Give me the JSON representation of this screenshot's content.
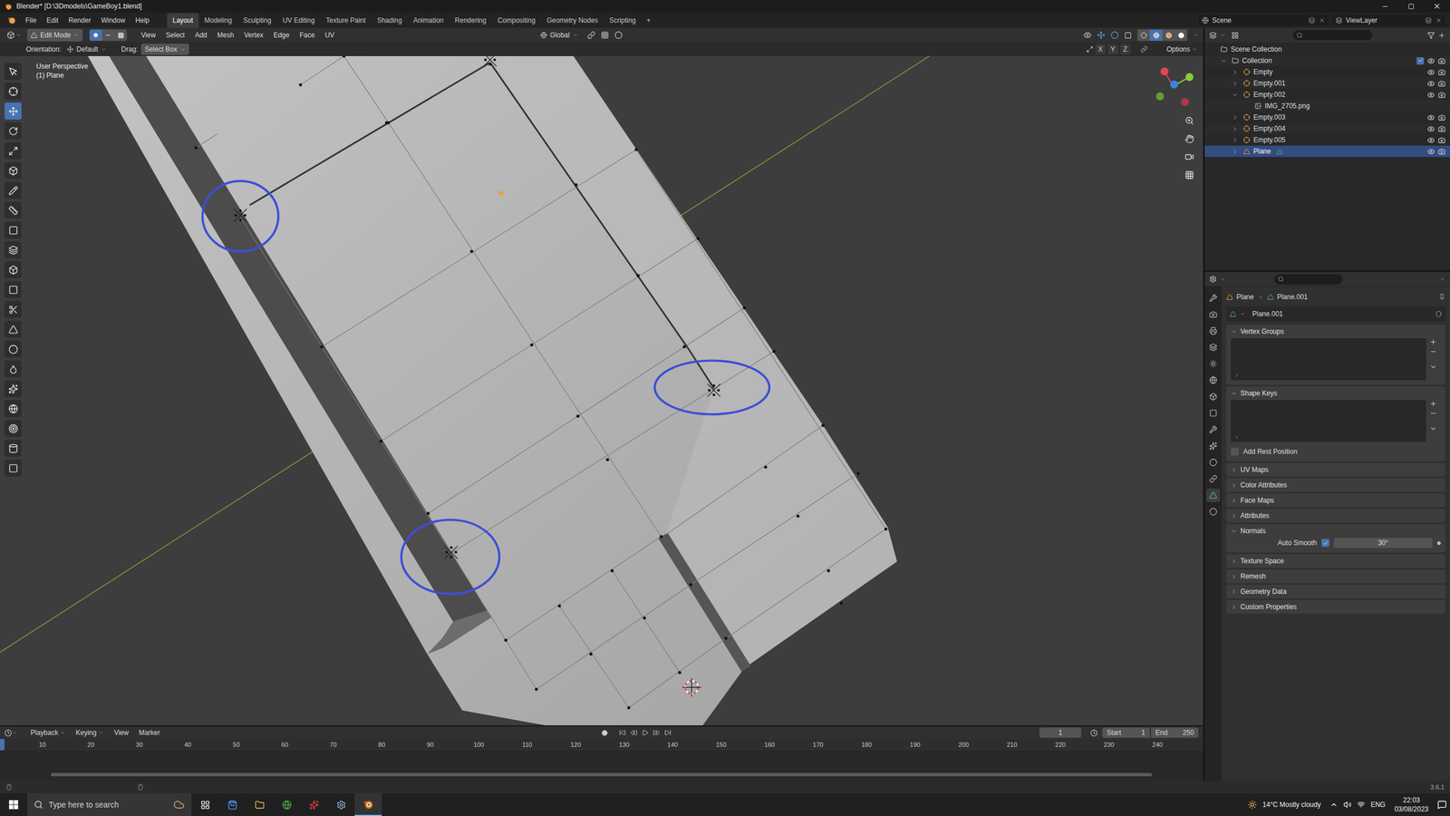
{
  "window": {
    "title": "Blender* [D:\\3Dmodels\\GameBoy1.blend]"
  },
  "menus": [
    "File",
    "Edit",
    "Render",
    "Window",
    "Help"
  ],
  "workspaces": [
    {
      "label": "Layout",
      "selected": true
    },
    {
      "label": "Modeling",
      "selected": false
    },
    {
      "label": "Sculpting",
      "selected": false
    },
    {
      "label": "UV Editing",
      "selected": false
    },
    {
      "label": "Texture Paint",
      "selected": false
    },
    {
      "label": "Shading",
      "selected": false
    },
    {
      "label": "Animation",
      "selected": false
    },
    {
      "label": "Rendering",
      "selected": false
    },
    {
      "label": "Compositing",
      "selected": false
    },
    {
      "label": "Geometry Nodes",
      "selected": false
    },
    {
      "label": "Scripting",
      "selected": false
    }
  ],
  "add_workspace": "+",
  "scene": "Scene",
  "view_layer": "ViewLayer",
  "viewport": {
    "mode": "Edit Mode",
    "select_modes": [
      {
        "selected": true
      },
      {
        "selected": false
      },
      {
        "selected": false
      }
    ],
    "menus": [
      "View",
      "Select",
      "Add",
      "Mesh",
      "Vertex",
      "Edge",
      "Face",
      "UV"
    ],
    "orientation": "Global",
    "shading": [
      {
        "selected": false
      },
      {
        "selected": true
      },
      {
        "selected": false
      },
      {
        "selected": false
      }
    ],
    "tool_settings": {
      "orientation_label": "Orientation:",
      "orientation": "Default",
      "drag_label": "Drag:",
      "drag": "Select Box",
      "mirror": [
        {
          "label": "X",
          "on": false
        },
        {
          "label": "Y",
          "on": false
        },
        {
          "label": "Z",
          "on": false
        }
      ],
      "options": "Options"
    },
    "overlay_text": [
      "User Perspective",
      "(1) Plane"
    ],
    "tools": [
      {
        "selected": false
      },
      {
        "selected": false
      },
      {
        "selected": true
      },
      {
        "selected": false
      },
      {
        "selected": false
      },
      {
        "selected": false
      },
      {
        "selected": false
      },
      {
        "selected": false
      },
      {
        "selected": false
      },
      {
        "selected": false
      },
      {
        "selected": false
      },
      {
        "selected": false
      },
      {
        "selected": false
      },
      {
        "selected": false
      },
      {
        "selected": false
      },
      {
        "selected": false
      },
      {
        "selected": false
      },
      {
        "selected": false
      },
      {
        "selected": false
      },
      {
        "selected": false
      },
      {
        "selected": false
      }
    ]
  },
  "outliner": {
    "rows": [
      {
        "name": "Scene Collection",
        "kind": "scene",
        "depth": 0,
        "selected": false
      },
      {
        "name": "Collection",
        "kind": "collection",
        "depth": 1,
        "expanded": true,
        "selected": false,
        "checked": true,
        "visible": true
      },
      {
        "name": "Empty",
        "kind": "empty",
        "depth": 2,
        "expanded": false,
        "selected": false,
        "visible": true
      },
      {
        "name": "Empty.001",
        "kind": "empty",
        "depth": 2,
        "expanded": false,
        "selected": false,
        "visible": true
      },
      {
        "name": "Empty.002",
        "kind": "empty",
        "depth": 2,
        "expanded": true,
        "selected": false,
        "visible": true
      },
      {
        "name": "IMG_2705.png",
        "kind": "image",
        "depth": 3,
        "selected": false
      },
      {
        "name": "Empty.003",
        "kind": "empty",
        "depth": 2,
        "expanded": false,
        "selected": false,
        "visible": true
      },
      {
        "name": "Empty.004",
        "kind": "empty",
        "depth": 2,
        "expanded": false,
        "selected": false,
        "visible": true
      },
      {
        "name": "Empty.005",
        "kind": "empty",
        "depth": 2,
        "expanded": false,
        "selected": false,
        "visible": true
      },
      {
        "name": "Plane",
        "kind": "mesh",
        "depth": 2,
        "expanded": false,
        "selected": true,
        "visible": true
      }
    ]
  },
  "properties": {
    "tabs": [
      {
        "selected": false
      },
      {
        "selected": false
      },
      {
        "selected": false
      },
      {
        "selected": false
      },
      {
        "selected": false
      },
      {
        "selected": false
      },
      {
        "selected": false
      },
      {
        "selected": false
      },
      {
        "selected": false
      },
      {
        "selected": false
      },
      {
        "selected": false
      },
      {
        "selected": false
      },
      {
        "selected": true
      },
      {
        "selected": false
      }
    ],
    "breadcrumb": [
      "Plane",
      "Plane.001"
    ],
    "datablock": "Plane.001",
    "panels": [
      {
        "title": "Vertex Groups",
        "expanded": true,
        "kind": "list"
      },
      {
        "title": "Shape Keys",
        "expanded": true,
        "kind": "list",
        "checkbox": {
          "label": "Add Rest Position",
          "checked": false
        }
      },
      {
        "title": "UV Maps",
        "expanded": false,
        "kind": "plain"
      },
      {
        "title": "Color Attributes",
        "expanded": false,
        "kind": "plain"
      },
      {
        "title": "Face Maps",
        "expanded": false,
        "kind": "plain"
      },
      {
        "title": "Attributes",
        "expanded": false,
        "kind": "plain"
      },
      {
        "title": "Normals",
        "expanded": true,
        "kind": "normals",
        "toggle": {
          "label": "Auto Smooth",
          "checked": true,
          "value": "30°"
        }
      },
      {
        "title": "Texture Space",
        "expanded": false,
        "kind": "plain"
      },
      {
        "title": "Remesh",
        "expanded": false,
        "kind": "plain"
      },
      {
        "title": "Geometry Data",
        "expanded": false,
        "kind": "plain"
      },
      {
        "title": "Custom Properties",
        "expanded": false,
        "kind": "plain"
      }
    ]
  },
  "timeline": {
    "menus": [
      "Playback",
      "Keying",
      "View",
      "Marker"
    ],
    "current_frame": "1",
    "start_label": "Start",
    "start": "1",
    "end_label": "End",
    "end": "250",
    "ruler": [
      "10",
      "20",
      "30",
      "40",
      "50",
      "60",
      "70",
      "80",
      "90",
      "100",
      "110",
      "120",
      "130",
      "140",
      "150",
      "160",
      "170",
      "180",
      "190",
      "200",
      "210",
      "220",
      "230",
      "240"
    ]
  },
  "status_bar": {
    "version": "3.6.1"
  },
  "taskbar": {
    "search_placeholder": "Type here to search",
    "weather": "14°C Mostly cloudy",
    "language": "ENG",
    "time": "22:03",
    "date": "03/08/2023"
  }
}
